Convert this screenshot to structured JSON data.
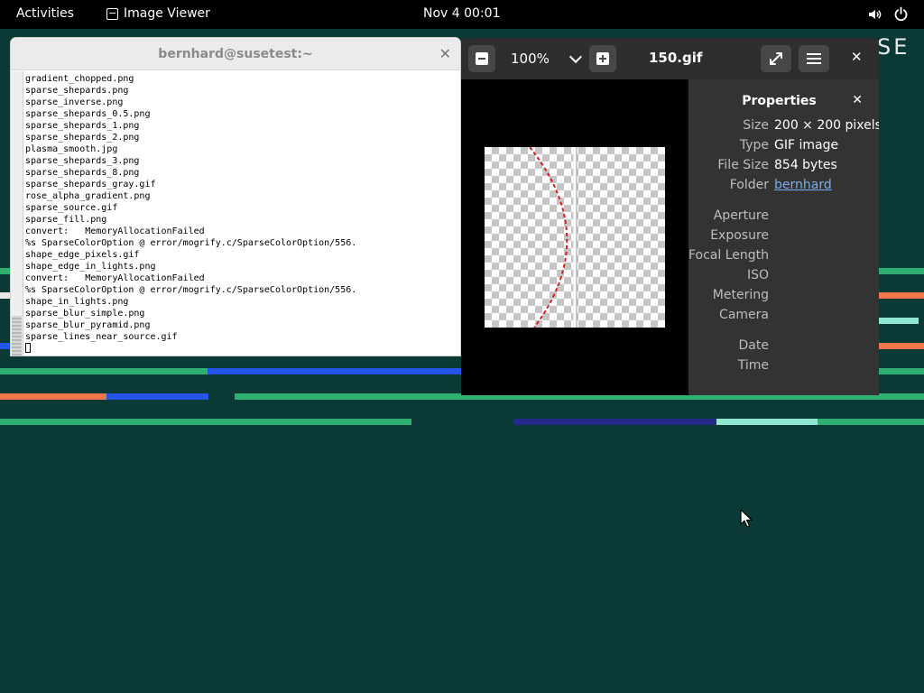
{
  "topbar": {
    "activities": "Activities",
    "app_name": "Image Viewer",
    "clock": "Nov 4  00:01",
    "volume_icon": "speaker-icon",
    "power_icon": "power-icon"
  },
  "desktop": {
    "brand_fragment": "SE",
    "colors": {
      "background": "#0b3a36",
      "green": "#30b070",
      "blue": "#2455e8",
      "orange": "#f0764a",
      "mint": "#8fe8cf",
      "navy": "#252a8a"
    }
  },
  "terminal": {
    "title": "bernhard@susetest:~",
    "lines": [
      "gradient_chopped.png",
      "sparse_shepards.png",
      "sparse_inverse.png",
      "sparse_shepards_0.5.png",
      "sparse_shepards_1.png",
      "sparse_shepards_2.png",
      "plasma_smooth.jpg",
      "sparse_shepards_3.png",
      "sparse_shepards_8.png",
      "sparse_shepards_gray.gif",
      "rose_alpha_gradient.png",
      "sparse_source.gif",
      "sparse_fill.png",
      "convert:   MemoryAllocationFailed",
      "%s SparseColorOption @ error/mogrify.c/SparseColorOption/556.",
      "shape_edge_pixels.gif",
      "shape_edge_in_lights.png",
      "convert:   MemoryAllocationFailed",
      "%s SparseColorOption @ error/mogrify.c/SparseColorOption/556.",
      "shape_in_lights.png",
      "sparse_blur_simple.png",
      "sparse_blur_pyramid.png",
      "sparse_lines_near_source.gif"
    ]
  },
  "viewer": {
    "zoom": "100%",
    "filename": "150.gif",
    "properties": {
      "title": "Properties",
      "rows": [
        {
          "key": "Size",
          "value": "200 × 200 pixels"
        },
        {
          "key": "Type",
          "value": "GIF image"
        },
        {
          "key": "File Size",
          "value": "854 bytes"
        },
        {
          "key": "Folder",
          "value": "bernhard",
          "link": true
        },
        {
          "key": "Aperture",
          "value": ""
        },
        {
          "key": "Exposure",
          "value": ""
        },
        {
          "key": "Focal Length",
          "value": ""
        },
        {
          "key": "ISO",
          "value": ""
        },
        {
          "key": "Metering",
          "value": ""
        },
        {
          "key": "Camera",
          "value": ""
        },
        {
          "key": "Date",
          "value": ""
        },
        {
          "key": "Time",
          "value": ""
        }
      ]
    }
  }
}
